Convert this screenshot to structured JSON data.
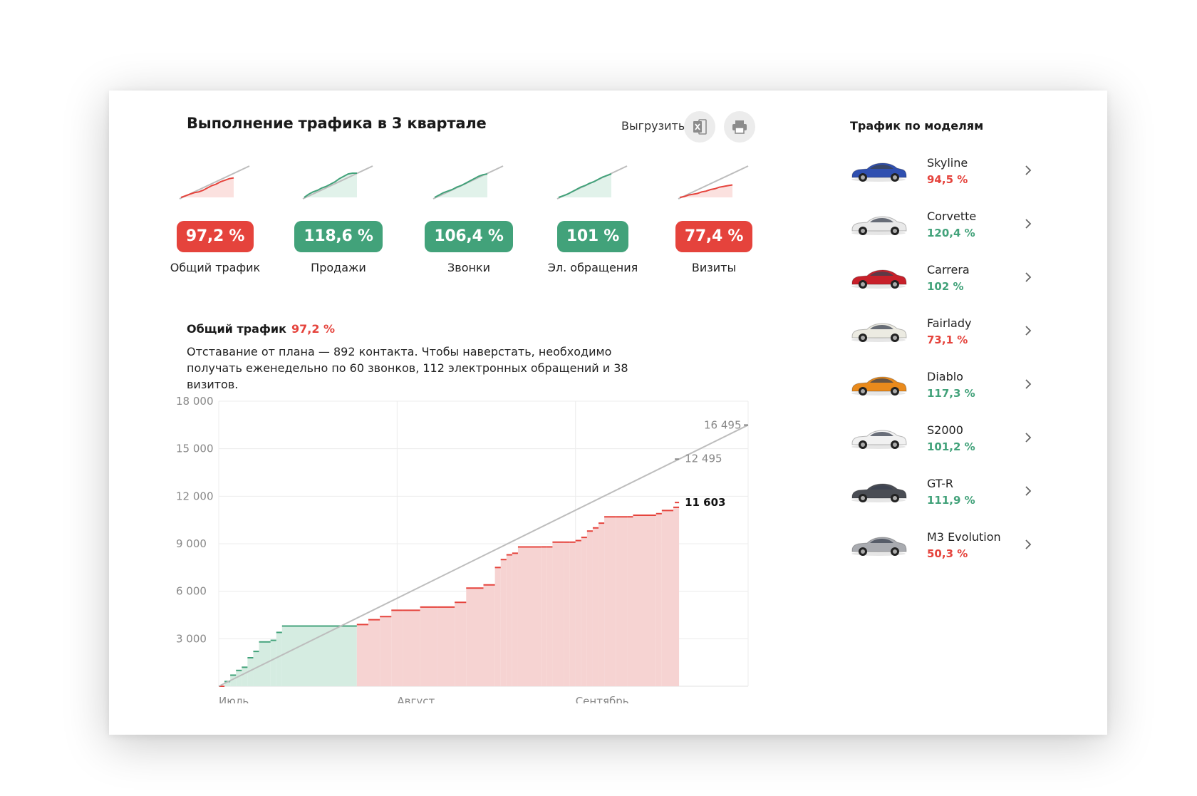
{
  "header": {
    "title": "Выполнение трафика в 3 квартале",
    "export_label": "Выгрузить",
    "excel_icon": "excel-icon",
    "print_icon": "printer-icon"
  },
  "kpis": [
    {
      "label": "Общий трафик",
      "value": "97,2 %",
      "status": "red"
    },
    {
      "label": "Продажи",
      "value": "118,6 %",
      "status": "green"
    },
    {
      "label": "Звонки",
      "value": "106,4 %",
      "status": "green"
    },
    {
      "label": "Эл. обращения",
      "value": "101 %",
      "status": "green"
    },
    {
      "label": "Визиты",
      "value": "77,4 %",
      "status": "red"
    }
  ],
  "detail": {
    "title": "Общий трафик",
    "pct": "97,2 %",
    "description": "Отставание от плана — 892 контакта. Чтобы наверстать, необходимо получать еженедельно по 60 звонков, 112 электронных обращений и 38 визитов."
  },
  "chart_data": {
    "type": "area",
    "ylim": [
      0,
      18000
    ],
    "yticks": [
      "18 000",
      "15 000",
      "12 000",
      "9 000",
      "6 000",
      "3 000"
    ],
    "xticks": [
      "Июль",
      "Август",
      "Сентябрь"
    ],
    "plan_end_label": "16 495",
    "plan_today_label": "12 495",
    "actual_today_label": "11 603",
    "plan": {
      "start": 0,
      "end": 16495
    },
    "actual_steps": [
      [
        0,
        0
      ],
      [
        1,
        300
      ],
      [
        2,
        700
      ],
      [
        3,
        1000
      ],
      [
        4,
        1200
      ],
      [
        5,
        1800
      ],
      [
        6,
        2200
      ],
      [
        7,
        2800
      ],
      [
        9,
        2900
      ],
      [
        10,
        3400
      ],
      [
        11,
        3800
      ],
      [
        24,
        3900
      ],
      [
        26,
        4200
      ],
      [
        28,
        4400
      ],
      [
        30,
        4800
      ],
      [
        32,
        4800
      ],
      [
        35,
        5000
      ],
      [
        38,
        5000
      ],
      [
        41,
        5300
      ],
      [
        43,
        6200
      ],
      [
        46,
        6400
      ],
      [
        48,
        7500
      ],
      [
        49,
        8000
      ],
      [
        50,
        8300
      ],
      [
        51,
        8400
      ],
      [
        52,
        8800
      ],
      [
        56,
        8800
      ],
      [
        57,
        8800
      ],
      [
        58,
        9100
      ],
      [
        60,
        9100
      ],
      [
        61,
        9100
      ],
      [
        62,
        9200
      ],
      [
        63,
        9400
      ],
      [
        64,
        9800
      ],
      [
        65,
        10000
      ],
      [
        66,
        10300
      ],
      [
        67,
        10700
      ],
      [
        69,
        10700
      ],
      [
        71,
        10700
      ],
      [
        72,
        10800
      ],
      [
        76,
        10900
      ],
      [
        77,
        11100
      ],
      [
        79,
        11300
      ],
      [
        80,
        11603
      ]
    ],
    "total_days": 92,
    "today_day": 80
  },
  "models": {
    "title": "Трафик по моделям",
    "items": [
      {
        "name": "Skyline",
        "pct": "94,5 %",
        "status": "red",
        "color": "#2f4fb0"
      },
      {
        "name": "Corvette",
        "pct": "120,4 %",
        "status": "green",
        "color": "#e9e9e9"
      },
      {
        "name": "Carrera",
        "pct": "102 %",
        "status": "green",
        "color": "#c8202a"
      },
      {
        "name": "Fairlady",
        "pct": "73,1 %",
        "status": "red",
        "color": "#ecebe2"
      },
      {
        "name": "Diablo",
        "pct": "117,3 %",
        "status": "green",
        "color": "#e98a1c"
      },
      {
        "name": "S2000",
        "pct": "101,2 %",
        "status": "green",
        "color": "#f1f1f1"
      },
      {
        "name": "GT-R",
        "pct": "111,9 %",
        "status": "green",
        "color": "#4a4d54"
      },
      {
        "name": "M3 Evolution",
        "pct": "50,3 %",
        "status": "red",
        "color": "#a9abb0"
      }
    ]
  }
}
